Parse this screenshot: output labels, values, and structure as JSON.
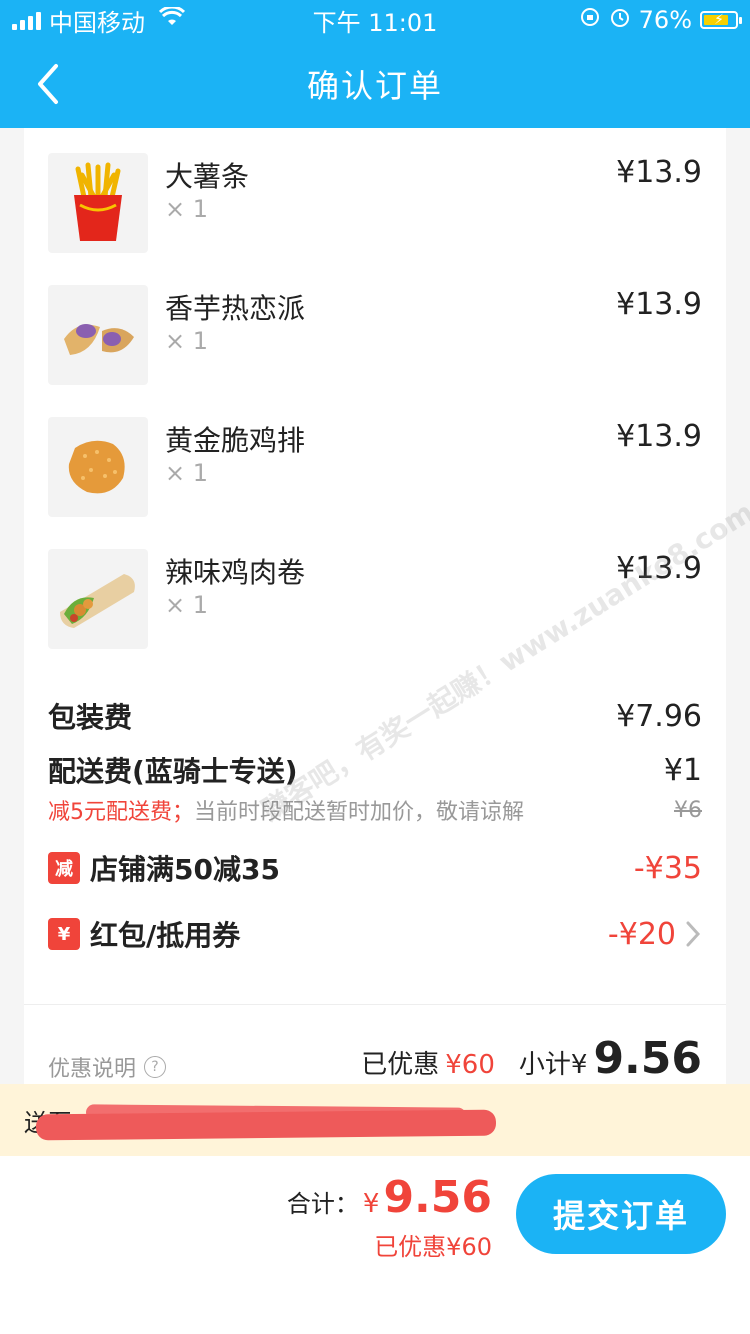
{
  "status": {
    "carrier": "中国移动",
    "time": "下午 11:01",
    "battery": "76%"
  },
  "nav": {
    "title": "确认订单"
  },
  "items": [
    {
      "name": "大薯条",
      "qty": "× 1",
      "price": "¥13.9"
    },
    {
      "name": "香芋热恋派",
      "qty": "× 1",
      "price": "¥13.9"
    },
    {
      "name": "黄金脆鸡排",
      "qty": "× 1",
      "price": "¥13.9"
    },
    {
      "name": "辣味鸡肉卷",
      "qty": "× 1",
      "price": "¥13.9"
    }
  ],
  "fees": {
    "packaging_label": "包装费",
    "packaging_amount": "¥7.96",
    "delivery_label": "配送费(蓝骑士专送)",
    "delivery_amount": "¥1",
    "delivery_note_red": "减5元配送费；",
    "delivery_note_gray": "当前时段配送暂时加价，敬请谅解",
    "delivery_old": "¥6"
  },
  "discounts": {
    "shop_badge": "减",
    "shop_label": "店铺满50减35",
    "shop_amount": "-¥35",
    "coupon_badge": "¥",
    "coupon_label": "红包/抵用券",
    "coupon_amount": "-¥20"
  },
  "summary": {
    "help_label": "优惠说明",
    "saved_label": "已优惠",
    "saved_amount": "¥60",
    "subtotal_label": "小计¥",
    "subtotal_amount": "9.56"
  },
  "address": {
    "label": "送至：恒"
  },
  "bottom": {
    "total_label": "合计：",
    "total_currency": "¥",
    "total_amount": "9.56",
    "total_saved": "已优惠¥60",
    "submit_label": "提交订单"
  },
  "watermark": "赚客吧，有奖一起赚！www.zuanke8.com",
  "colors": {
    "brand_blue": "#1bb3f5",
    "discount_red": "#f0443a",
    "address_bg": "#fff4d9"
  }
}
